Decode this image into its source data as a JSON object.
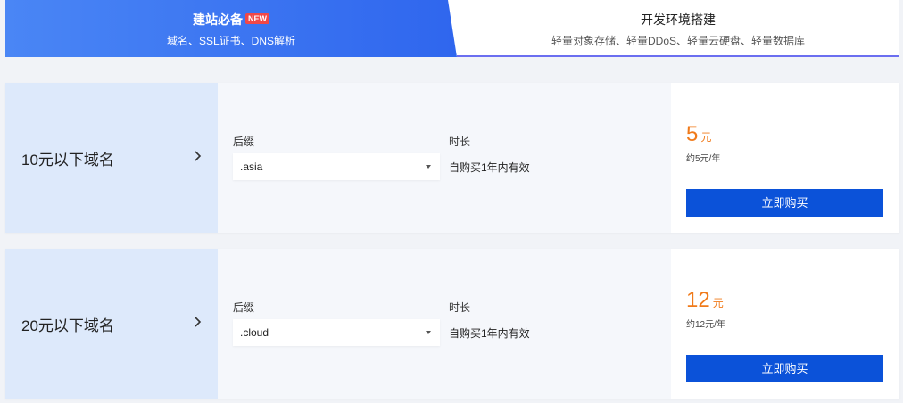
{
  "tabs": [
    {
      "title": "建站必备",
      "badge": "NEW",
      "subtitle": "域名、SSL证书、DNS解析",
      "active": true
    },
    {
      "title": "开发环境搭建",
      "subtitle": "轻量对象存储、轻量DDoS、轻量云硬盘、轻量数据库",
      "active": false
    }
  ],
  "products": [
    {
      "name": "10元以下域名",
      "suffix_label": "后缀",
      "suffix_value": ".asia",
      "duration_label": "时长",
      "duration_value": "自购买1年内有效",
      "price": "5",
      "price_unit": "元",
      "price_sub": "约5元/年",
      "buy_label": "立即购买"
    },
    {
      "name": "20元以下域名",
      "suffix_label": "后缀",
      "suffix_value": ".cloud",
      "duration_label": "时长",
      "duration_value": "自购买1年内有效",
      "price": "12",
      "price_unit": "元",
      "price_sub": "约12元/年",
      "buy_label": "立即购买"
    }
  ],
  "icons": {
    "chevron": "chevron-right-icon",
    "dropdown": "caret-down-icon"
  },
  "colors": {
    "accent": "#2f66ee",
    "price": "#f07a1a",
    "button": "#0b52d9",
    "badge": "#f04848"
  }
}
